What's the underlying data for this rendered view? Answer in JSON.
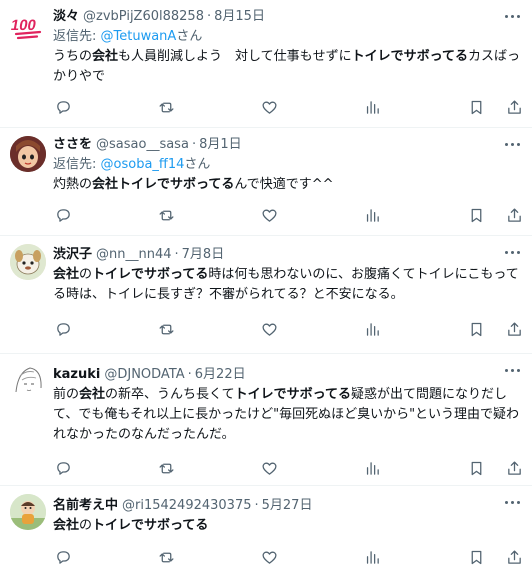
{
  "tweets": [
    {
      "name": "淡々",
      "handle": "@zvbPijZ60l88258",
      "date": "8月15日",
      "reply_prefix": "返信先: ",
      "reply_mention": "@TetuwanA",
      "reply_suffix": "さん",
      "text": [
        {
          "t": "うちの",
          "b": false
        },
        {
          "t": "会社",
          "b": true
        },
        {
          "t": "も人員削減しよう　対して仕事もせずに",
          "b": false
        },
        {
          "t": "トイレでサボってる",
          "b": true
        },
        {
          "t": "カスばっかりやで",
          "b": false
        }
      ],
      "avatar": "hundred-points-emoji"
    },
    {
      "name": "ささを",
      "handle": "@sasao__sasa",
      "date": "8月1日",
      "reply_prefix": "返信先: ",
      "reply_mention": "@osoba_ff14",
      "reply_suffix": "さん",
      "text": [
        {
          "t": "灼熱の",
          "b": false
        },
        {
          "t": "会社トイレでサボってる",
          "b": true
        },
        {
          "t": "んで快適です^^",
          "b": false
        }
      ],
      "avatar": "character-portrait"
    },
    {
      "name": "渋沢子",
      "handle": "@nn__nn44",
      "date": "7月8日",
      "text": [
        {
          "t": "会社",
          "b": true
        },
        {
          "t": "の",
          "b": false
        },
        {
          "t": "トイレでサボってる",
          "b": true
        },
        {
          "t": "時は何も思わないのに、お腹痛くてトイレにこもってる時は、トイレに長すぎ？不審がられてる？と不安になる。",
          "b": false
        }
      ],
      "avatar": "cartoon-character"
    },
    {
      "name": "kazuki",
      "handle": "@DJNODATA",
      "date": "6月22日",
      "text": [
        {
          "t": "前の",
          "b": false
        },
        {
          "t": "会社",
          "b": true
        },
        {
          "t": "の新卒、うんち長くて",
          "b": false
        },
        {
          "t": "トイレでサボってる",
          "b": true
        },
        {
          "t": "疑惑が出て問題になりだして、でも俺もそれ以上に長かったけど\"毎回死ぬほど臭いから\"という理由で疑われなかったのなんだったんだ。",
          "b": false
        }
      ],
      "avatar": "sketch-face"
    },
    {
      "name": "名前考え中",
      "handle": "@ri1542492430375",
      "date": "5月27日",
      "text": [
        {
          "t": "会社",
          "b": true
        },
        {
          "t": "の",
          "b": false
        },
        {
          "t": "トイレでサボってる",
          "b": true
        }
      ],
      "avatar": "cartoon-figure"
    }
  ],
  "colors": {
    "text": "#0f1419",
    "secondary": "#536471",
    "link": "#1d9bf0",
    "divider": "#eff3f4"
  }
}
